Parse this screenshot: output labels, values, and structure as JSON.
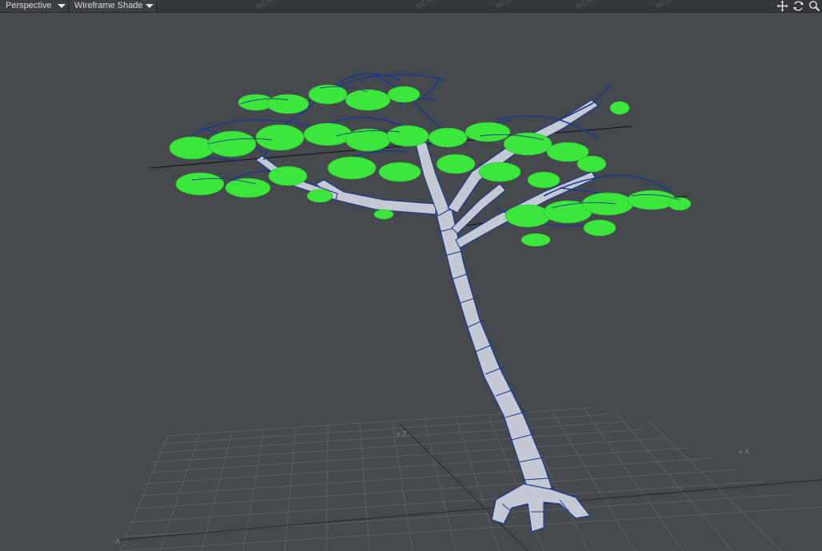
{
  "toolbar": {
    "view_mode": "Perspective",
    "shading_mode": "Wireframe Shade"
  },
  "icons": {
    "move": "move-view-icon",
    "rotate": "rotate-view-icon",
    "zoom": "zoom-view-icon"
  },
  "axes": {
    "pos_z": "+Z",
    "pos_x": "+X",
    "neg_x": "-X"
  },
  "watermark": "MOO",
  "colors": {
    "viewport_bg": "#45484c",
    "grid": "#5c5f63",
    "trunk_fill": "#c5c9d4",
    "wire": "#1a3a8f",
    "foliage": "#3ce63c"
  }
}
